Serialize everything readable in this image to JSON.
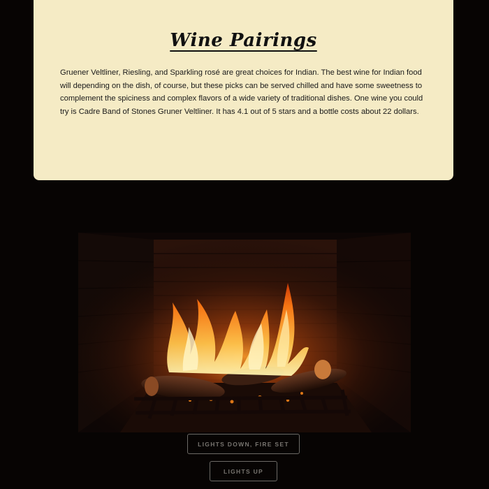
{
  "card": {
    "title": "Wine Pairings",
    "body": "Gruener Veltliner, Riesling, and Sparkling rosé are great choices for Indian. The best wine for Indian food will depending on the dish, of course, but these picks can be served chilled and have some sweetness to complement the spiciness and complex flavors of a wide variety of traditional dishes. One wine you could try is Cadre Band of Stones Gruner Veltliner. It has 4.1 out of 5 stars and a bottle costs about 22 dollars."
  },
  "fireplace": {
    "icon": "fireplace-video"
  },
  "buttons": {
    "lights_down": "LIGHTS DOWN, FIRE SET",
    "lights_up": "LIGHTS UP"
  },
  "colors": {
    "background": "#070403",
    "card": "#f5ebc5",
    "button_border": "#6c6a66",
    "button_text": "#77746f"
  }
}
